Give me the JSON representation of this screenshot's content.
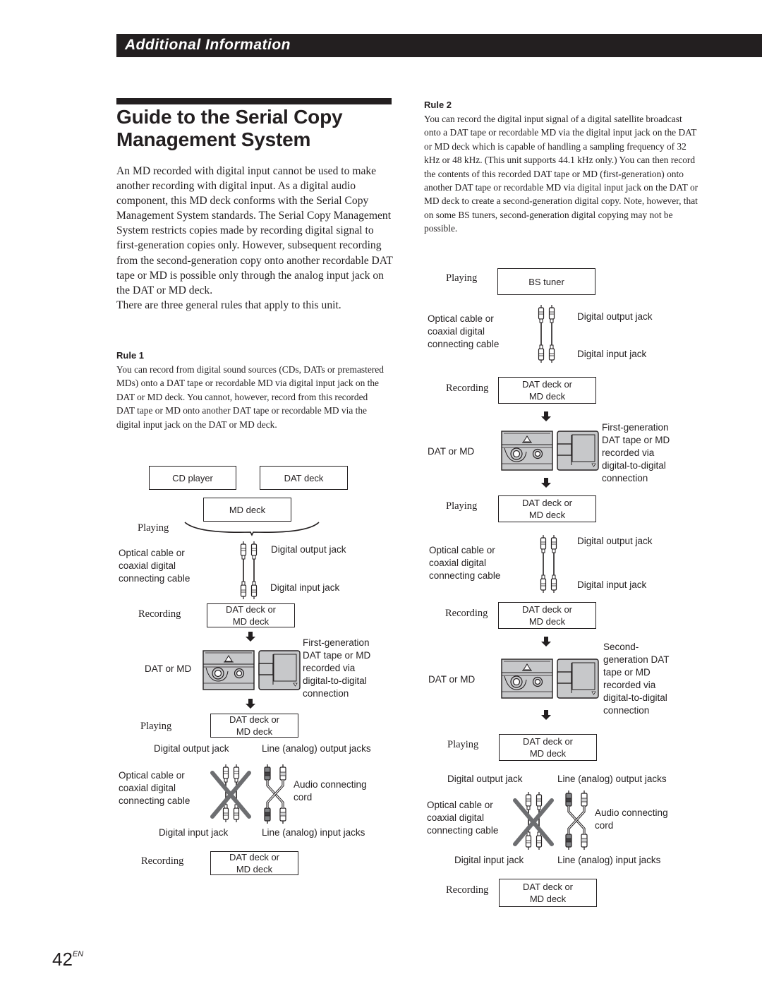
{
  "header": {
    "section_title": "Additional Information"
  },
  "page": {
    "title": "Guide to the Serial Copy Management System",
    "title_line1": "Guide to the Serial Copy",
    "title_line2": "Management System",
    "intro": "An MD recorded with digital input cannot be used to make another recording with digital input.  As a digital audio component, this MD deck conforms with the Serial Copy Management System standards.  The Serial Copy Management System restricts copies made by recording digital signal to first-generation copies only. However, subsequent recording from the second-generation copy onto another recordable DAT tape or MD is possible only through the analog input jack on the DAT or MD deck.",
    "intro2": "There are three general rules that apply to this unit.",
    "page_number": "42",
    "page_suffix": "EN"
  },
  "rule1": {
    "heading": "Rule 1",
    "text": "You can record from digital sound sources (CDs, DATs or premastered MDs) onto a DAT tape or recordable MD via digital input jack on the DAT or MD deck.  You cannot, however, record from this recorded DAT tape or MD onto another DAT tape or recordable MD via the digital input jack on the DAT or MD deck.",
    "diagram": {
      "source1": "CD player",
      "source2": "DAT deck",
      "source3": "MD deck",
      "playing": "Playing",
      "recording": "Recording",
      "cable_label": [
        "Optical cable or",
        "coaxial digital",
        "connecting cable"
      ],
      "digital_output": "Digital output jack",
      "digital_input": "Digital input jack",
      "deck_line1": "DAT deck or",
      "deck_line2": "MD deck",
      "media_label": "DAT or MD",
      "media_desc": [
        "First-generation",
        "DAT tape or MD",
        "recorded via",
        "digital-to-digital",
        "connection"
      ],
      "line_output": "Line (analog) output jacks",
      "line_input": "Line (analog) input jacks",
      "audio_cord": [
        "Audio connecting",
        "cord"
      ]
    }
  },
  "rule2": {
    "heading": "Rule 2",
    "text": "You can record the digital input signal of a digital satellite broadcast onto a DAT tape or recordable MD via the digital input jack on the DAT or MD deck which is capable of handling a sampling frequency of 32 kHz or 48 kHz.  (This unit supports 44.1 kHz only.)  You can then record the contents of this recorded DAT tape or MD (first-generation) onto another DAT tape or recordable MD via digital input jack on the DAT or MD deck to create a second-generation digital copy.  Note, however, that on some BS tuners, second-generation digital copying may not be possible.",
    "diagram": {
      "source": "BS tuner",
      "playing": "Playing",
      "recording": "Recording",
      "cable_label": [
        "Optical cable or",
        "coaxial digital",
        "connecting cable"
      ],
      "digital_output": "Digital output jack",
      "digital_input": "Digital input jack",
      "deck_line1": "DAT deck or",
      "deck_line2": "MD deck",
      "media_label": "DAT or MD",
      "media_desc_first": [
        "First-generation",
        "DAT tape or MD",
        "recorded via",
        "digital-to-digital",
        "connection"
      ],
      "media_desc_second": [
        "Second-",
        "generation DAT",
        "tape or MD",
        "recorded via",
        "digital-to-digital",
        "connection"
      ],
      "line_output": "Line (analog) output jacks",
      "line_input": "Line (analog) input jacks",
      "audio_cord": [
        "Audio connecting",
        "cord"
      ]
    }
  }
}
